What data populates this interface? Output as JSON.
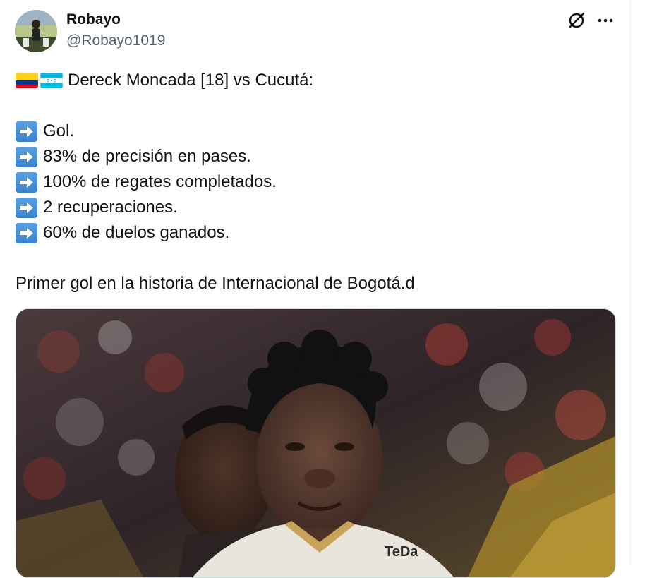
{
  "author": {
    "display_name": "Robayo",
    "handle": "@Robayo1019"
  },
  "icons": {
    "grok": "grok-icon",
    "more": "more-dots-icon",
    "bullet": "right-arrow-emoji",
    "flags": [
      "colombia-flag",
      "honduras-flag"
    ]
  },
  "tweet": {
    "headline": "Dereck Moncada [18] vs Cucutá:",
    "stats": [
      "Gol.",
      "83% de precisión en pases.",
      "100% de regates completados.",
      "2 recuperaciones.",
      "60% de duelos ganados."
    ],
    "closing": "Primer gol en la historia de Internacional de Bogotá.d"
  },
  "media": {
    "jersey_sponsor": "TeDa"
  },
  "colors": {
    "text": "#0f1419",
    "secondary": "#536471",
    "arrow_emoji": "#3b82cc",
    "border": "#cfd9de"
  }
}
